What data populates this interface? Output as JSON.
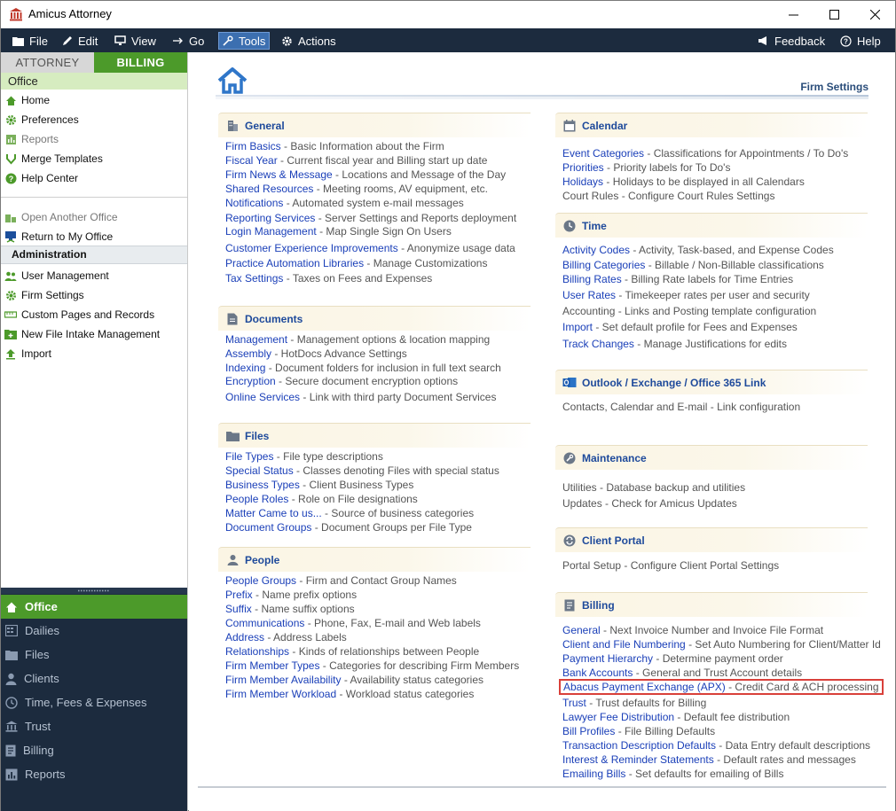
{
  "window": {
    "title": "Amicus Attorney"
  },
  "menu": {
    "items": [
      {
        "label": "File",
        "icon": "folder-icon"
      },
      {
        "label": "Edit",
        "icon": "pencil-icon"
      },
      {
        "label": "View",
        "icon": "monitor-icon"
      },
      {
        "label": "Go",
        "icon": "arrow-right-icon"
      },
      {
        "label": "Tools",
        "icon": "wrench-icon"
      },
      {
        "label": "Actions",
        "icon": "gear-icon"
      }
    ],
    "feedback": "Feedback",
    "help": "Help",
    "active": "Tools"
  },
  "sidebar": {
    "tabs": {
      "attorney": "ATTORNEY",
      "billing": "BILLING"
    },
    "office_label": "Office",
    "items": [
      {
        "label": "Home"
      },
      {
        "label": "Preferences"
      },
      {
        "label": "Reports"
      },
      {
        "label": "Merge Templates"
      },
      {
        "label": "Help Center"
      }
    ],
    "items2": [
      {
        "label": "Open Another Office"
      },
      {
        "label": "Return to My Office"
      }
    ],
    "admin_header": "Administration",
    "admin_items": [
      {
        "label": "User Management"
      },
      {
        "label": "Firm Settings"
      },
      {
        "label": "Custom Pages and Records"
      },
      {
        "label": "New File Intake Management"
      },
      {
        "label": "Import"
      }
    ],
    "bottom_nav": [
      {
        "label": "Office"
      },
      {
        "label": "Dailies"
      },
      {
        "label": "Files"
      },
      {
        "label": "Clients"
      },
      {
        "label": "Time, Fees & Expenses"
      },
      {
        "label": "Trust"
      },
      {
        "label": "Billing"
      },
      {
        "label": "Reports"
      }
    ]
  },
  "main": {
    "page_title": "Firm Settings",
    "sections": {
      "general": {
        "title": "General",
        "rows": [
          {
            "link": "Firm Basics",
            "desc": " - Basic Information about the Firm"
          },
          {
            "link": "Fiscal Year",
            "desc": " - Current fiscal year and Billing start up date"
          },
          {
            "link": "Firm News & Message",
            "desc": " - Locations and Message of the Day"
          },
          {
            "link": "Shared Resources",
            "desc": " - Meeting rooms, AV equipment, etc."
          },
          {
            "link": "Notifications",
            "desc": " - Automated system e-mail messages"
          },
          {
            "link": "Reporting Services",
            "desc": " - Server Settings and Reports deployment"
          },
          {
            "link": "Login Management",
            "desc": " - Map Single Sign On Users"
          },
          {
            "link": "Customer Experience Improvements",
            "desc": " - Anonymize usage data"
          },
          {
            "link": "Practice Automation Libraries",
            "desc": " - Manage Customizations"
          },
          {
            "link": "Tax Settings",
            "desc": " - Taxes on Fees and Expenses"
          }
        ]
      },
      "documents": {
        "title": "Documents",
        "rows": [
          {
            "link": "Management",
            "desc": " - Management options & location mapping"
          },
          {
            "link": "Assembly",
            "desc": " - HotDocs Advance Settings"
          },
          {
            "link": "Indexing",
            "desc": " - Document folders for inclusion in full text search"
          },
          {
            "link": "Encryption",
            "desc": " - Secure document encryption options"
          },
          {
            "link": "Online Services",
            "desc": " - Link with third party Document Services"
          }
        ]
      },
      "files": {
        "title": "Files",
        "rows": [
          {
            "link": "File Types",
            "desc": " - File type descriptions"
          },
          {
            "link": "Special Status",
            "desc": " - Classes denoting Files with special status"
          },
          {
            "link": "Business Types",
            "desc": " - Client Business Types"
          },
          {
            "link": "People Roles",
            "desc": " - Role on File designations"
          },
          {
            "link": "Matter Came to us...",
            "desc": " - Source of business categories"
          },
          {
            "link": "Document Groups",
            "desc": " - Document Groups per File Type"
          }
        ]
      },
      "people": {
        "title": "People",
        "rows": [
          {
            "link": "People Groups",
            "desc": " - Firm and Contact Group Names"
          },
          {
            "link": "Prefix",
            "desc": " - Name prefix options"
          },
          {
            "link": "Suffix",
            "desc": " - Name suffix options"
          },
          {
            "link": "Communications",
            "desc": " - Phone, Fax, E-mail and Web labels"
          },
          {
            "link": "Address",
            "desc": " - Address Labels"
          },
          {
            "link": "Relationships",
            "desc": " - Kinds of relationships between People"
          },
          {
            "link": "Firm Member Types",
            "desc": " - Categories for describing Firm Members"
          },
          {
            "link": "Firm Member Availability",
            "desc": " - Availability status categories"
          },
          {
            "link": "Firm Member Workload",
            "desc": " - Workload status categories"
          }
        ]
      },
      "calendar": {
        "title": "Calendar",
        "rows": [
          {
            "link": "Event Categories",
            "desc": " - Classifications for Appointments / To Do's"
          },
          {
            "link": "Priorities",
            "desc": " - Priority labels for To Do's"
          },
          {
            "link": "Holidays",
            "desc": " - Holidays to be displayed in all Calendars"
          },
          {
            "plain": "Court Rules",
            "desc": " - Configure Court Rules Settings"
          }
        ]
      },
      "time": {
        "title": "Time",
        "rows": [
          {
            "link": "Activity Codes",
            "desc": " - Activity, Task-based, and Expense Codes"
          },
          {
            "link": "Billing Categories",
            "desc": " - Billable / Non-Billable classifications"
          },
          {
            "link": "Billing Rates",
            "desc": " - Billing Rate labels for Time Entries"
          },
          {
            "link": "User Rates",
            "desc": " - Timekeeper rates per user and security"
          },
          {
            "plain": "Accounting",
            "desc": " - Links and Posting template configuration"
          },
          {
            "link": "Import",
            "desc": " - Set default profile for Fees and Expenses"
          },
          {
            "link": "Track Changes",
            "desc": " - Manage Justifications for edits"
          }
        ]
      },
      "outlook": {
        "title": "Outlook / Exchange / Office 365 Link",
        "rows": [
          {
            "plain": "Contacts, Calendar and E-mail",
            "desc": " - Link configuration"
          }
        ]
      },
      "maintenance": {
        "title": "Maintenance",
        "rows": [
          {
            "plain": "Utilities",
            "desc": " - Database backup and utilities"
          },
          {
            "plain": "Updates",
            "desc": " - Check for Amicus Updates"
          }
        ]
      },
      "portal": {
        "title": "Client Portal",
        "rows": [
          {
            "plain": "Portal Setup",
            "desc": " - Configure Client Portal Settings"
          }
        ]
      },
      "billing": {
        "title": "Billing",
        "rows": [
          {
            "link": "General",
            "desc": " - Next Invoice Number and Invoice File Format"
          },
          {
            "link": "Client and File Numbering",
            "desc": " - Set Auto Numbering for Client/Matter Id"
          },
          {
            "link": "Payment Hierarchy",
            "desc": " - Determine payment order"
          },
          {
            "link": "Bank Accounts",
            "desc": " - General and Trust Account details"
          },
          {
            "link": "Abacus Payment Exchange (APX)",
            "desc": " - Credit Card & ACH processing"
          },
          {
            "link": "Trust",
            "desc": " - Trust defaults for Billing"
          },
          {
            "link": "Lawyer Fee Distribution",
            "desc": " - Default fee distribution"
          },
          {
            "link": "Bill Profiles",
            "desc": " - File Billing Defaults"
          },
          {
            "link": "Transaction Description Defaults",
            "desc": " - Data Entry default descriptions"
          },
          {
            "link": "Interest & Reminder Statements",
            "desc": " - Default rates and messages"
          },
          {
            "link": "Emailing Bills",
            "desc": " - Set defaults for emailing of Bills"
          }
        ]
      }
    }
  },
  "colors": {
    "menubar": "#1c2b3e",
    "accent_green": "#4c9a2a",
    "link_blue": "#1a3fb8",
    "highlight_red": "#d9403a"
  }
}
